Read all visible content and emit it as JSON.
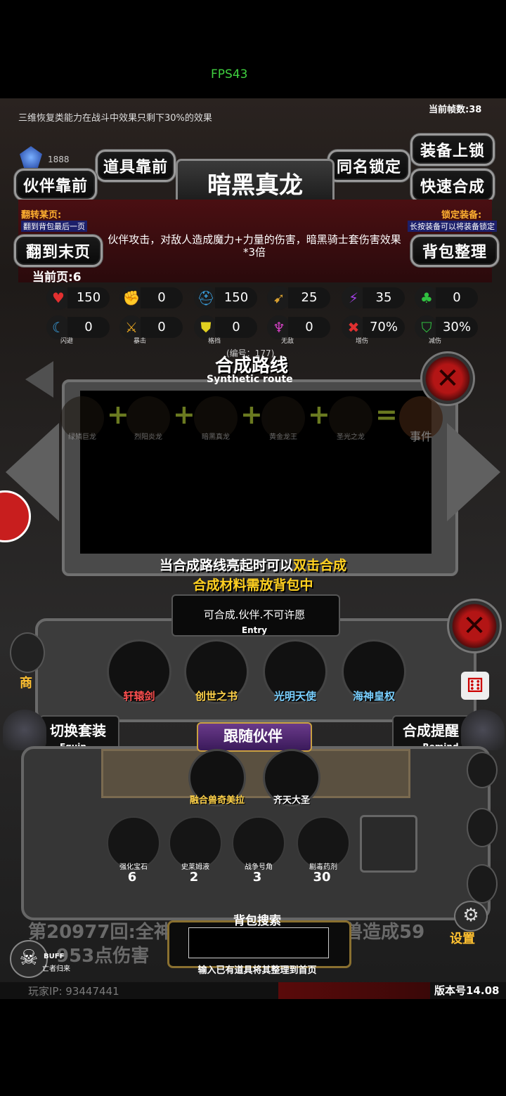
{
  "fps": "FPS43",
  "frame_rate": "当前帧数:38",
  "notice": "三维恢复类能力在战斗中效果只剩下30%的效果",
  "crystal_count": "1888",
  "buttons": {
    "equip_lock": "装备上锁",
    "item_front": "道具靠前",
    "same_name_lock": "同名锁定",
    "partner_front": "伙伴靠前",
    "quick_synth": "快速合成",
    "last_page": "翻到末页",
    "sort_bag": "背包整理"
  },
  "item_title": "暗黑真龙",
  "flip_page": {
    "title": "翻转某页:",
    "desc": "翻到背包最后一页"
  },
  "lock_equip": {
    "title": "锁定装备:",
    "desc": "长按装备可以将装备锁定"
  },
  "description": "伙伴攻击，对敌人造成魔力+力量的伤害，暗黑骑士套伤害效果*3倍",
  "current_page": "当前页:6",
  "stats": [
    {
      "icon": "heart-icon",
      "glyph": "♥",
      "color": "#e23030",
      "value": "150",
      "label": ""
    },
    {
      "icon": "strength-icon",
      "glyph": "✊",
      "color": "#e0c020",
      "value": "0",
      "label": ""
    },
    {
      "icon": "helmet-icon",
      "glyph": "⛑",
      "color": "#3aa0e0",
      "value": "150",
      "label": ""
    },
    {
      "icon": "bow-icon",
      "glyph": "➹",
      "color": "#d8a030",
      "value": "25",
      "label": ""
    },
    {
      "icon": "lightning-icon",
      "glyph": "⚡",
      "color": "#a040e0",
      "value": "35",
      "label": ""
    },
    {
      "icon": "clover-icon",
      "glyph": "♣",
      "color": "#30c040",
      "value": "0",
      "label": ""
    },
    {
      "icon": "dodge-icon",
      "glyph": "☾",
      "color": "#3aa0e0",
      "value": "0",
      "label": "闪避"
    },
    {
      "icon": "crit-icon",
      "glyph": "⚔",
      "color": "#e0a020",
      "value": "0",
      "label": "暴击"
    },
    {
      "icon": "block-icon",
      "glyph": "⛊",
      "color": "#e0d020",
      "value": "0",
      "label": "格挡"
    },
    {
      "icon": "invincible-icon",
      "glyph": "♆",
      "color": "#d040c0",
      "value": "0",
      "label": "无敌"
    },
    {
      "icon": "damage-up-icon",
      "glyph": "✖",
      "color": "#e03030",
      "value": "70%",
      "label": "增伤"
    },
    {
      "icon": "damage-down-icon",
      "glyph": "⛉",
      "color": "#30c040",
      "value": "30%",
      "label": "减伤"
    }
  ],
  "number_label": "(编号：177)",
  "synth_route": {
    "title": "合成路线",
    "subtitle": "Synthetic route"
  },
  "route_items": [
    "绿鳞巨龙",
    "烈阳炎龙",
    "暗黑真龙",
    "黄金龙王",
    "圣光之龙",
    "事件"
  ],
  "hint1_a": "当合成路线亮起时可以",
  "hint1_b": "双击合成",
  "hint2": "合成材料需放背包中",
  "entry": {
    "title": "可合成.伙伴.不可许愿",
    "subtitle": "Entry"
  },
  "gear": [
    "轩辕剑",
    "创世之书",
    "光明天使",
    "海神皇权"
  ],
  "switch_equip": {
    "title": "切换套装",
    "subtitle": "Equip"
  },
  "synth_remind": {
    "title": "合成提醒",
    "subtitle": "Remind"
  },
  "follow_partner": "跟随伙伴",
  "partners": [
    "融合兽奇美拉",
    "齐天大圣"
  ],
  "materials": [
    {
      "name": "强化宝石",
      "count": "6"
    },
    {
      "name": "史莱姆液",
      "count": "2"
    },
    {
      "name": "战争号角",
      "count": "3"
    },
    {
      "name": "剧毒药剂",
      "count": "30"
    }
  ],
  "log_line1": "第20977回:全神贯",
  "log_line1_end": "兽造成59",
  "log_line2": "953点伤害",
  "bag_search": {
    "title": "背包搜索",
    "hint": "输入已有道具将其整理到首页"
  },
  "buff": {
    "label": "BUFF",
    "name": "亡者归来"
  },
  "side_shop": "商",
  "settings": "设置",
  "player_ip": "玩家IP: 93447441",
  "version": "版本号14.08"
}
